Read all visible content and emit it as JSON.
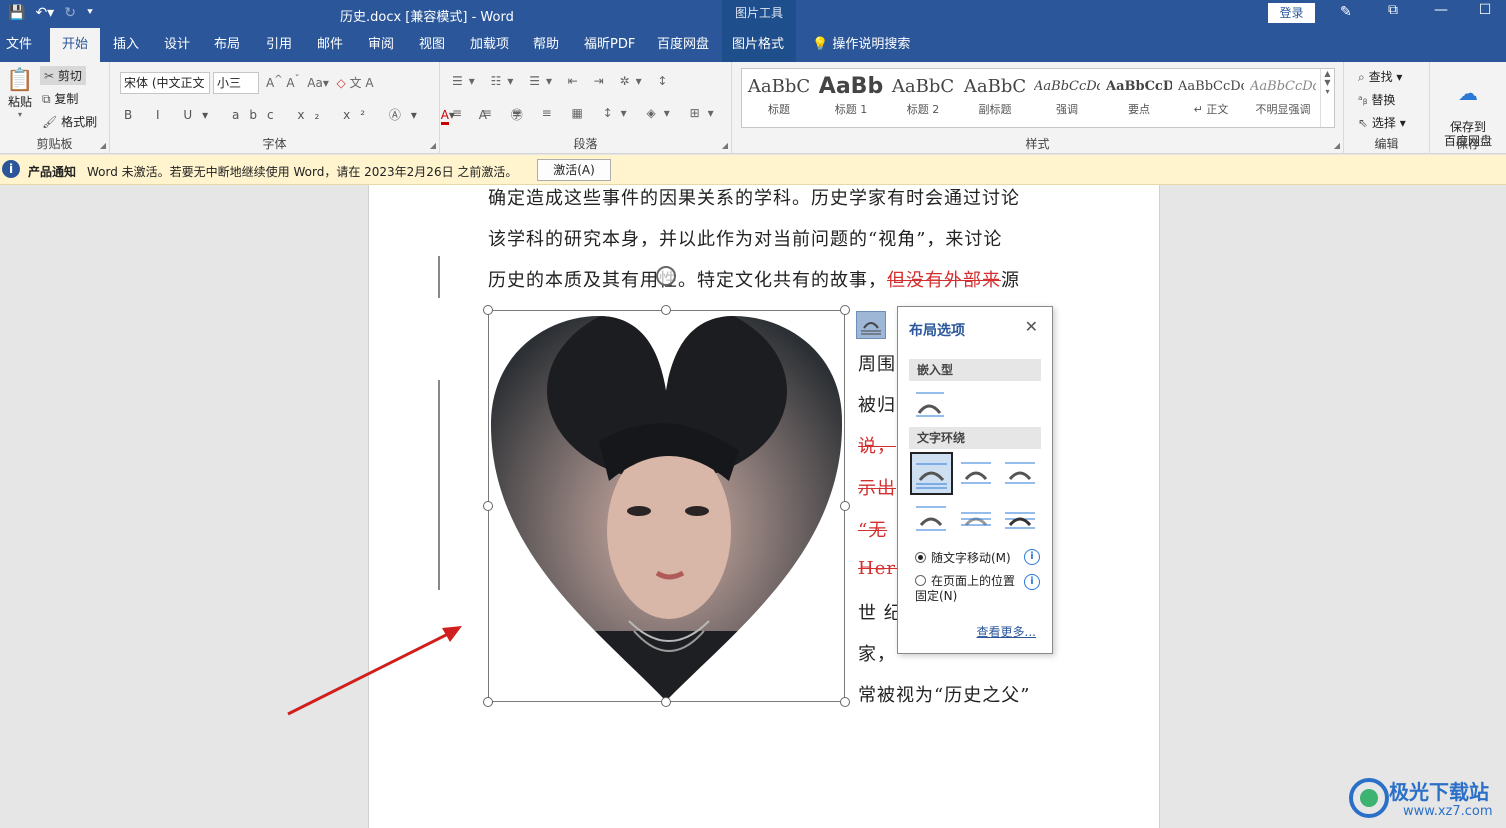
{
  "titlebar": {
    "title": "历史.docx [兼容模式]  -  Word",
    "context_tab_group": "图片工具",
    "login": "登录"
  },
  "tabs": [
    "文件",
    "开始",
    "插入",
    "设计",
    "布局",
    "引用",
    "邮件",
    "审阅",
    "视图",
    "加载项",
    "帮助",
    "福昕PDF",
    "百度网盘",
    "图片格式"
  ],
  "tell_me": "操作说明搜索",
  "clipboard": {
    "paste": "粘贴",
    "cut": "剪切",
    "copy": "复制",
    "format_painter": "格式刷",
    "label": "剪贴板"
  },
  "font": {
    "name": "宋体 (中文正文",
    "size": "小三",
    "label": "字体"
  },
  "paragraph": {
    "label": "段落"
  },
  "styles": {
    "label": "样式",
    "items": [
      {
        "sample": "AaBbC",
        "name": "标题"
      },
      {
        "sample": "AaBb",
        "name": "标题 1"
      },
      {
        "sample": "AaBbC",
        "name": "标题 2"
      },
      {
        "sample": "AaBbC",
        "name": "副标题"
      },
      {
        "sample": "AaBbCcDd",
        "name": "强调"
      },
      {
        "sample": "AaBbCcD",
        "name": "要点"
      },
      {
        "sample": "AaBbCcDd",
        "name": "↵ 正文"
      },
      {
        "sample": "AaBbCcDd",
        "name": "不明显强调"
      }
    ]
  },
  "editing": {
    "find": "查找",
    "replace": "替换",
    "select": "选择",
    "label": "编辑"
  },
  "save": {
    "save_to": "保存到\n百度网盘",
    "label": "保存"
  },
  "notification": {
    "title": "产品通知",
    "message": "Word 未激活。若要无中断地继续使用 Word，请在 2023年2月26日 之前激活。",
    "button": "激活(A)"
  },
  "document": {
    "line1": "确定造成这些事件的因果关系的学科。历史学家有时会通过讨论",
    "line2": "该学科的研究本身，并以此作为对当前问题的“视角”，来讨论",
    "line3_a": "历史的本质及其有用性。特定文化共有的故事，",
    "line3_del": "但没有外部来",
    "line3_b": "源",
    "r1": "周围",
    "r2": "被归",
    "r3": "说，",
    "r4": "示出",
    "r5": "“无",
    "r6": "Hero",
    "r7": "世 纪",
    "r8": "家，",
    "r9": "常被视为“历史之父”"
  },
  "layout_popup": {
    "title": "布局选项",
    "inline_section": "嵌入型",
    "wrap_section": "文字环绕",
    "move_with_text": "随文字移动(M)",
    "fix_position": "在页面上的位置\n固定(N)",
    "see_more": "查看更多..."
  },
  "watermark": {
    "text": "极光下载站",
    "url": "www.xz7.com"
  },
  "colors": {
    "brand": "#2b579a",
    "tracked_deletion": "#d32f2f",
    "arrow": "#d11f1f"
  }
}
